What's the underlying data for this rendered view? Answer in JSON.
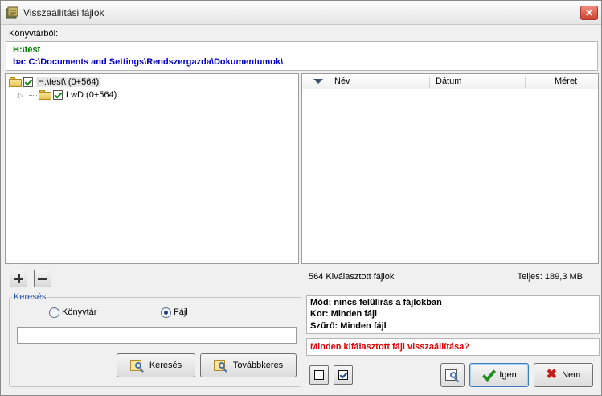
{
  "window": {
    "title": "Visszaállítási fájlok",
    "close_symbol": "✕"
  },
  "source": {
    "label": "Könyvtárból:",
    "line1": "H:\\test",
    "line2": "ba: C:\\Documents and Settings\\Rendszergazda\\Dokumentumok\\"
  },
  "tree": {
    "items": [
      {
        "label": "H:\\test\\ (0+564)",
        "checked": true
      },
      {
        "label": "LwD (0+564)",
        "checked": true
      }
    ]
  },
  "file_list": {
    "columns": [
      "Név",
      "Dátum",
      "Méret"
    ],
    "rows": []
  },
  "summary": {
    "selected": "564 Kiválasztott fájlok",
    "total": "Teljes: 189,3 MB"
  },
  "search": {
    "legend": "Keresés",
    "option_directory": "Könyvtár",
    "option_file": "Fájl",
    "selected_option": "Fájl",
    "input_value": "",
    "search_button": "Keresés",
    "next_button": "Továbbkeres"
  },
  "info": {
    "mode": "Mód: nincs felülírás a fájlokban",
    "age": "Kor: Minden fájl",
    "filter": "Szűrő: Minden fájl",
    "question": "Minden kifálasztott fájl visszaállítása?"
  },
  "actions": {
    "yes": "Igen",
    "no": "Nem"
  },
  "colors": {
    "path_green": "#008000",
    "path_blue": "#0000c0",
    "question_red": "#e00000",
    "legend_blue": "#1c4fa8"
  }
}
